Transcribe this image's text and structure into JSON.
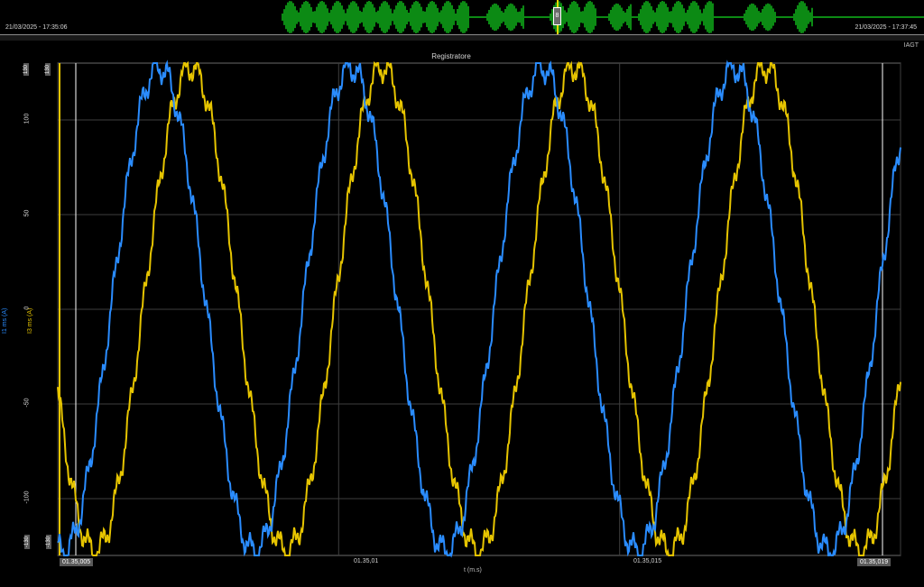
{
  "overview": {
    "start_time": "21/03/2025 - 17:35:06",
    "end_time": "21/03/2025 - 17:37:45",
    "color": "#0c8a14",
    "marker_color": "#e8d500",
    "marker_label": "8"
  },
  "header": {
    "corner_label": "IAGT"
  },
  "chart_data": {
    "type": "line",
    "title": "Registratore",
    "xlabel": "t (m.s)",
    "ylabel_series_a": "I1 ms (A)",
    "ylabel_series_b": "I3 ms (A)",
    "x_ticks": [
      "01.35,005",
      "01.35,01",
      "01.35,015",
      "01.35,019"
    ],
    "y_ticks": [
      "100",
      "50",
      "0",
      "-50",
      "-100"
    ],
    "y_box_top": "130",
    "y_box_bottom": "-130",
    "ylim": [
      -130,
      130
    ],
    "grid": true,
    "series": [
      {
        "color": "#e6c400",
        "amplitude": 128,
        "cycles": 4.4,
        "phase_deg": 200
      },
      {
        "color": "#2a8cff",
        "amplitude": 128,
        "cycles": 4.4,
        "phase_deg": 260
      }
    ]
  }
}
